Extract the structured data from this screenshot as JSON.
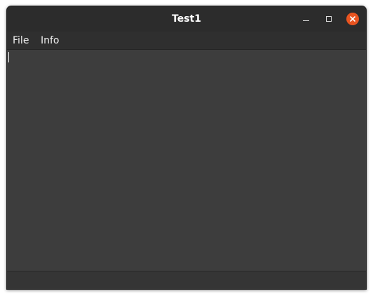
{
  "window": {
    "title": "Test1"
  },
  "menubar": {
    "items": [
      {
        "label": "File"
      },
      {
        "label": "Info"
      }
    ]
  },
  "editor": {
    "text": ""
  },
  "statusbar": {
    "text": ""
  },
  "icons": {
    "minimize": "minimize-icon",
    "maximize": "maximize-icon",
    "close": "close-icon"
  },
  "colors": {
    "close_button": "#e95420",
    "titlebar": "#2c2c2c",
    "editor_background": "#3d3d3d"
  }
}
